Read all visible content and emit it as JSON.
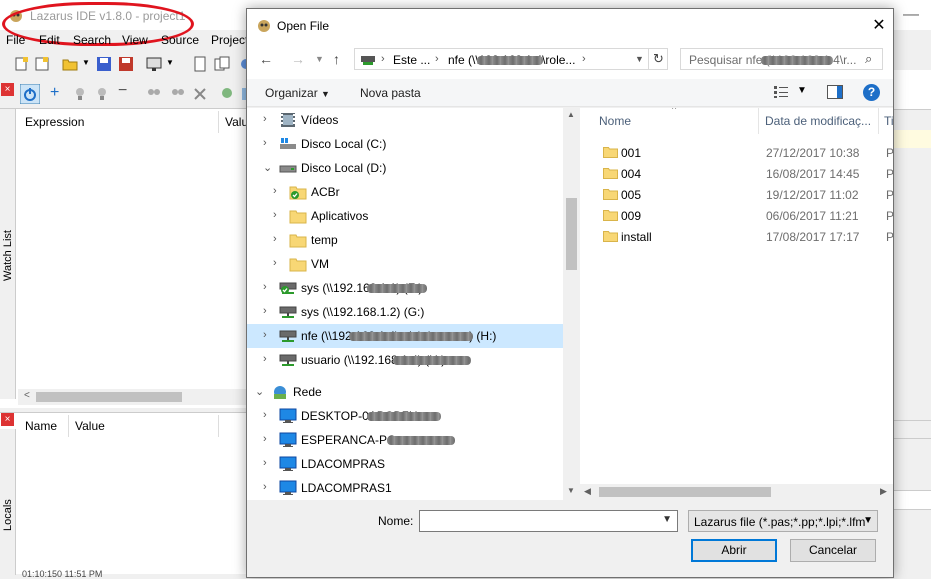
{
  "ide": {
    "title": "Lazarus IDE v1.8.0 - project1",
    "menu": [
      "File",
      "Edit",
      "Search",
      "View",
      "Source",
      "Project"
    ],
    "watch_tab": "Watch List",
    "watch_headers": [
      "Expression",
      "Valu"
    ],
    "locals_tab": "Locals",
    "locals_headers": [
      "Name",
      "Value"
    ],
    "status_text": "01:10:150 11:51 PM"
  },
  "dialog": {
    "title": "Open File",
    "address": {
      "segments": [
        "Este ...",
        "nfe (\\\\192.168.1.4\\role..."
      ]
    },
    "search_placeholder": "Pesquisar nfe (\\\\192.168.1.4\\r...",
    "toolbar": {
      "organize": "Organizar",
      "new_folder": "Nova pasta"
    },
    "nav_tree": [
      {
        "label": "Vídeos",
        "icon": "video-folder-icon",
        "indent": 0,
        "chevron": "right"
      },
      {
        "label": "Disco Local (C:)",
        "icon": "windows-drive-icon",
        "indent": 0,
        "chevron": "right"
      },
      {
        "label": "Disco Local (D:)",
        "icon": "drive-icon",
        "indent": 0,
        "chevron": "down"
      },
      {
        "label": "ACBr",
        "icon": "acbr-folder-icon",
        "indent": 1,
        "chevron": "right"
      },
      {
        "label": "Aplicativos",
        "icon": "folder-icon",
        "indent": 1,
        "chevron": "right"
      },
      {
        "label": "temp",
        "icon": "folder-icon",
        "indent": 1,
        "chevron": "right"
      },
      {
        "label": "VM",
        "icon": "folder-icon",
        "indent": 1,
        "chevron": "right"
      },
      {
        "label": "sys (\\\\192.168.1.1) (F:)",
        "icon": "disconnected-network-drive-icon",
        "indent": 0,
        "chevron": "right"
      },
      {
        "label": "sys (\\\\192.168.1.2) (G:)",
        "icon": "network-drive-icon",
        "indent": 0,
        "chevron": "right"
      },
      {
        "label": "nfe (\\\\192.168.1.4\\role\\sistemas) (H:)",
        "icon": "network-drive-icon",
        "indent": 0,
        "chevron": "right",
        "selected": true
      },
      {
        "label": "usuario (\\\\192.168.1.4) (U:)",
        "icon": "network-drive-icon",
        "indent": 0,
        "chevron": "right"
      },
      {
        "label": "Rede",
        "icon": "network-icon",
        "indent": -1,
        "chevron": "down"
      },
      {
        "label": "DESKTOP-0ABCD7H",
        "icon": "computer-icon",
        "indent": 0,
        "chevron": "right"
      },
      {
        "label": "ESPERANCA-PC",
        "icon": "computer-icon",
        "indent": 0,
        "chevron": "right"
      },
      {
        "label": "LDACOMPRAS",
        "icon": "computer-icon",
        "indent": 0,
        "chevron": "right"
      },
      {
        "label": "LDACOMPRAS1",
        "icon": "computer-icon",
        "indent": 0,
        "chevron": "right"
      }
    ],
    "columns": {
      "name": "Nome",
      "date": "Data de modificaç...",
      "type": "Ti"
    },
    "files": [
      {
        "name": "001",
        "date": "27/12/2017 10:38",
        "type": "Pa"
      },
      {
        "name": "004",
        "date": "16/08/2017 14:45",
        "type": "Pa"
      },
      {
        "name": "005",
        "date": "19/12/2017 11:02",
        "type": "Pa"
      },
      {
        "name": "009",
        "date": "06/06/2017 11:21",
        "type": "Pa"
      },
      {
        "name": "install",
        "date": "17/08/2017 17:17",
        "type": "Pa"
      }
    ],
    "name_label": "Nome:",
    "name_value": "",
    "filter": "Lazarus file (*.pas;*.pp;*.lpi;*.lfm",
    "open_button": "Abrir",
    "cancel_button": "Cancelar"
  },
  "colors": {
    "accent": "#0078d7",
    "selection": "#cce8ff",
    "folder": "#f8d775",
    "highlight_circle": "#e0141e"
  }
}
